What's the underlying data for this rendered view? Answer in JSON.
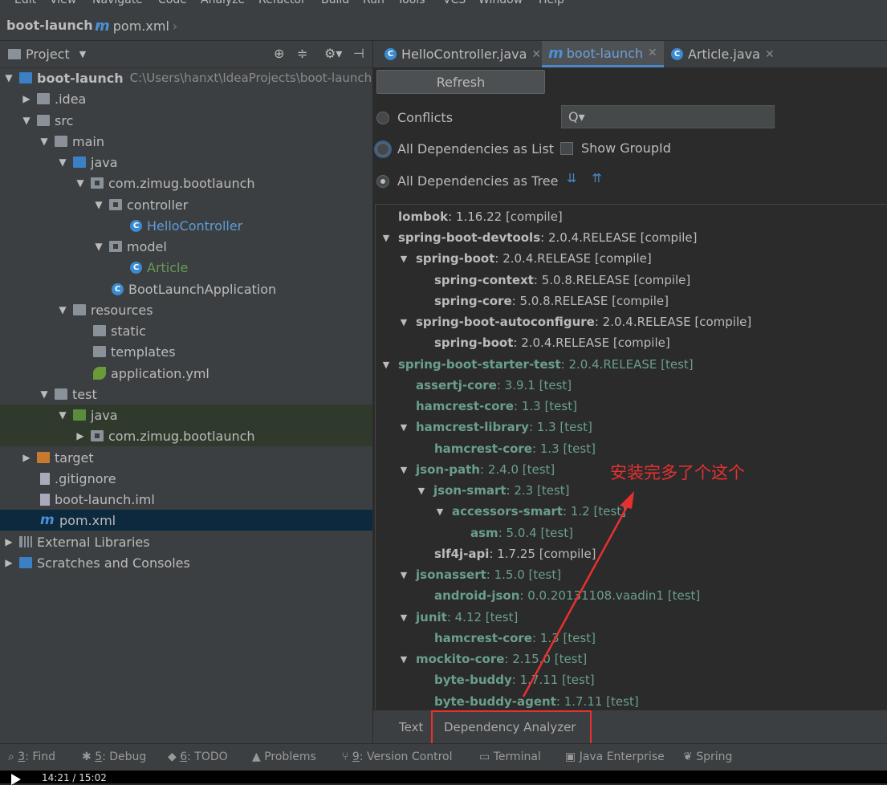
{
  "menu": [
    "Edit",
    "View",
    "Navigate",
    "Code",
    "Analyze",
    "Refactor",
    "Build",
    "Run",
    "Tools",
    "VCS",
    "Window",
    "Help"
  ],
  "breadcrumb": {
    "project": "boot-launch",
    "file_icon": "m",
    "file": "pom.xml"
  },
  "project_panel": {
    "title": "Project",
    "rows": [
      {
        "label": "boot-launch",
        "path": "C:\\Users\\hanxt\\IdeaProjects\\boot-launch"
      },
      {
        "label": ".idea"
      },
      {
        "label": "src"
      },
      {
        "label": "main"
      },
      {
        "label": "java"
      },
      {
        "label": "com.zimug.bootlaunch"
      },
      {
        "label": "controller"
      },
      {
        "label": "HelloController"
      },
      {
        "label": "model"
      },
      {
        "label": "Article"
      },
      {
        "label": "BootLaunchApplication"
      },
      {
        "label": "resources"
      },
      {
        "label": "static"
      },
      {
        "label": "templates"
      },
      {
        "label": "application.yml"
      },
      {
        "label": "test"
      },
      {
        "label": "java"
      },
      {
        "label": "com.zimug.bootlaunch"
      },
      {
        "label": "target"
      },
      {
        "label": ".gitignore"
      },
      {
        "label": "boot-launch.iml"
      },
      {
        "label": "pom.xml"
      },
      {
        "label": "External Libraries"
      },
      {
        "label": "Scratches and Consoles"
      }
    ],
    "class_icon": "C"
  },
  "editor_tabs": [
    {
      "label": "HelloController.java",
      "icon": "C"
    },
    {
      "label": "boot-launch",
      "icon": "m"
    },
    {
      "label": "Article.java",
      "icon": "C"
    }
  ],
  "analyzer": {
    "refresh": "Refresh",
    "conflicts": "Conflicts",
    "as_list": "All Dependencies as List",
    "as_tree": "All Dependencies as Tree",
    "show_group": "Show GroupId",
    "search_icon": "Q▾"
  },
  "dependencies": [
    {
      "name": "lombok",
      "version": " : 1.16.22 [compile]"
    },
    {
      "name": "spring-boot-devtools",
      "version": " : 2.0.4.RELEASE [compile]"
    },
    {
      "name": "spring-boot",
      "version": " : 2.0.4.RELEASE [compile]"
    },
    {
      "name": "spring-context",
      "version": " : 5.0.8.RELEASE [compile]"
    },
    {
      "name": "spring-core",
      "version": " : 5.0.8.RELEASE [compile]"
    },
    {
      "name": "spring-boot-autoconfigure",
      "version": " : 2.0.4.RELEASE [compile]"
    },
    {
      "name": "spring-boot",
      "version": " : 2.0.4.RELEASE [compile]"
    },
    {
      "name": "spring-boot-starter-test",
      "version": " : 2.0.4.RELEASE [test]"
    },
    {
      "name": "assertj-core",
      "version": " : 3.9.1 [test]"
    },
    {
      "name": "hamcrest-core",
      "version": " : 1.3 [test]"
    },
    {
      "name": "hamcrest-library",
      "version": " : 1.3 [test]"
    },
    {
      "name": "hamcrest-core",
      "version": " : 1.3 [test]"
    },
    {
      "name": "json-path",
      "version": " : 2.4.0 [test]"
    },
    {
      "name": "json-smart",
      "version": " : 2.3 [test]"
    },
    {
      "name": "accessors-smart",
      "version": " : 1.2 [test]"
    },
    {
      "name": "asm",
      "version": " : 5.0.4 [test]"
    },
    {
      "name": "slf4j-api",
      "version": " : 1.7.25 [compile]"
    },
    {
      "name": "jsonassert",
      "version": " : 1.5.0 [test]"
    },
    {
      "name": "android-json",
      "version": " : 0.0.20131108.vaadin1 [test]"
    },
    {
      "name": "junit",
      "version": " : 4.12 [test]"
    },
    {
      "name": "hamcrest-core",
      "version": " : 1.3 [test]"
    },
    {
      "name": "mockito-core",
      "version": " : 2.15.0 [test]"
    },
    {
      "name": "byte-buddy",
      "version": " : 1.7.11 [test]"
    },
    {
      "name": "byte-buddy-agent",
      "version": " : 1.7.11 [test]"
    }
  ],
  "bottom_tabs": {
    "text": "Text",
    "analyzer": "Dependency Analyzer"
  },
  "annotation": "安装完多了个这个",
  "statusbar": [
    {
      "num": "3",
      "label": ": Find"
    },
    {
      "num": "5",
      "label": ": Debug"
    },
    {
      "num": "6",
      "label": ": TODO"
    },
    {
      "num": "",
      "label": "Problems"
    },
    {
      "num": "9",
      "label": ": Version Control"
    },
    {
      "num": "",
      "label": "Terminal"
    },
    {
      "num": "",
      "label": "Java Enterprise"
    },
    {
      "num": "",
      "label": "Spring"
    }
  ],
  "player": {
    "time": "14:21 / 15:02"
  },
  "colors": {
    "accent": "#4a88c7",
    "annotation": "#e83030",
    "test_dep": "#6a9f8a"
  }
}
